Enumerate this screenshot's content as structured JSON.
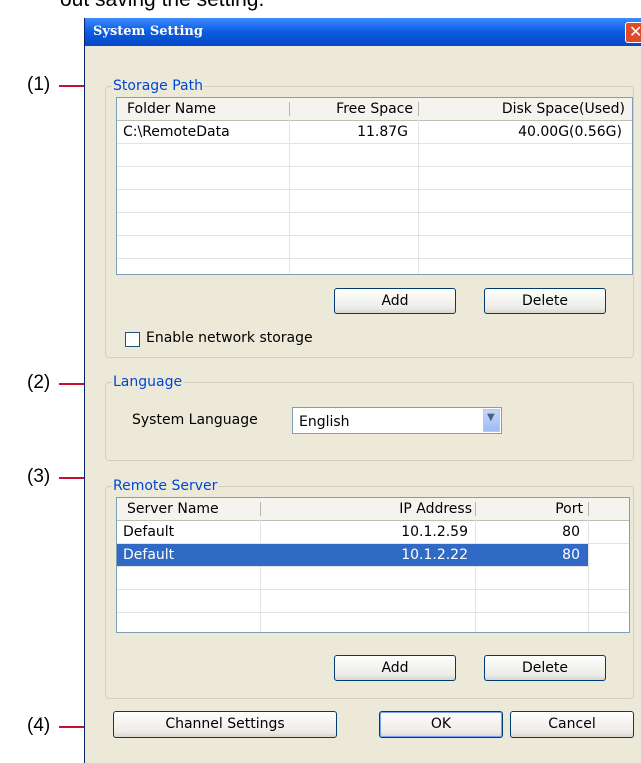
{
  "doc_text": "out saving the setting.",
  "callouts": [
    "(1)",
    "(2)",
    "(3)",
    "(4)"
  ],
  "window": {
    "title": "System Setting",
    "close_glyph": "✕",
    "storage_path": {
      "legend": "Storage Path",
      "columns": [
        "Folder Name",
        "Free Space",
        "Disk Space(Used)"
      ],
      "rows": [
        {
          "folder": "C:\\RemoteData",
          "free": "11.87G",
          "disk": "40.00G(0.56G)"
        }
      ],
      "add_label": "Add",
      "delete_label": "Delete",
      "network_storage_label": "Enable network storage",
      "network_storage_checked": false
    },
    "language": {
      "legend": "Language",
      "label": "System Language",
      "value": "English"
    },
    "remote_server": {
      "legend": "Remote Server",
      "columns": [
        "Server Name",
        "IP Address",
        "Port"
      ],
      "rows": [
        {
          "name": "Default",
          "ip": "10.1.2.59",
          "port": "80",
          "selected": false
        },
        {
          "name": "Default",
          "ip": "10.1.2.22",
          "port": "80",
          "selected": true
        }
      ],
      "add_label": "Add",
      "delete_label": "Delete"
    },
    "buttons": {
      "channel_settings": "Channel Settings",
      "ok": "OK",
      "cancel": "Cancel"
    }
  }
}
